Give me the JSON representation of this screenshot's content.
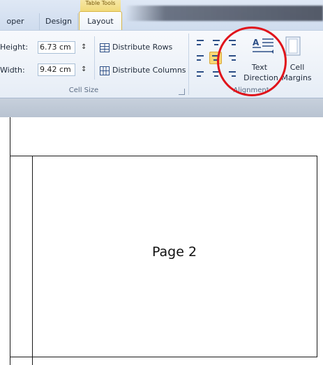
{
  "tabs": {
    "contextual_title": "Table Tools",
    "prev_partial": "oper",
    "design": "Design",
    "layout": "Layout"
  },
  "cell_size": {
    "height_label": "Height:",
    "height_value": "6.73 cm",
    "width_label": "Width:",
    "width_value": "9.42 cm",
    "distribute_rows": "Distribute Rows",
    "distribute_columns": "Distribute Columns",
    "group_label": "Cell Size"
  },
  "alignment": {
    "text_direction_line1": "Text",
    "text_direction_line2": "Direction",
    "cell_margins_line1": "Cell",
    "cell_margins_line2": "Margins",
    "group_label": "Alignment",
    "selected_index": 4
  },
  "document": {
    "page_label": "Page 2"
  },
  "colors": {
    "accent": "#f8d775",
    "highlight_circle": "#e0141b",
    "icon_blue": "#2d4f87"
  },
  "icons": {
    "spin": "up-down-arrows",
    "distribute_rows": "distribute-rows-icon",
    "distribute_columns": "distribute-columns-icon",
    "text_direction": "text-direction-icon",
    "cell_margins": "cell-margins-icon",
    "dialog_launcher": "dialog-launcher-icon"
  }
}
